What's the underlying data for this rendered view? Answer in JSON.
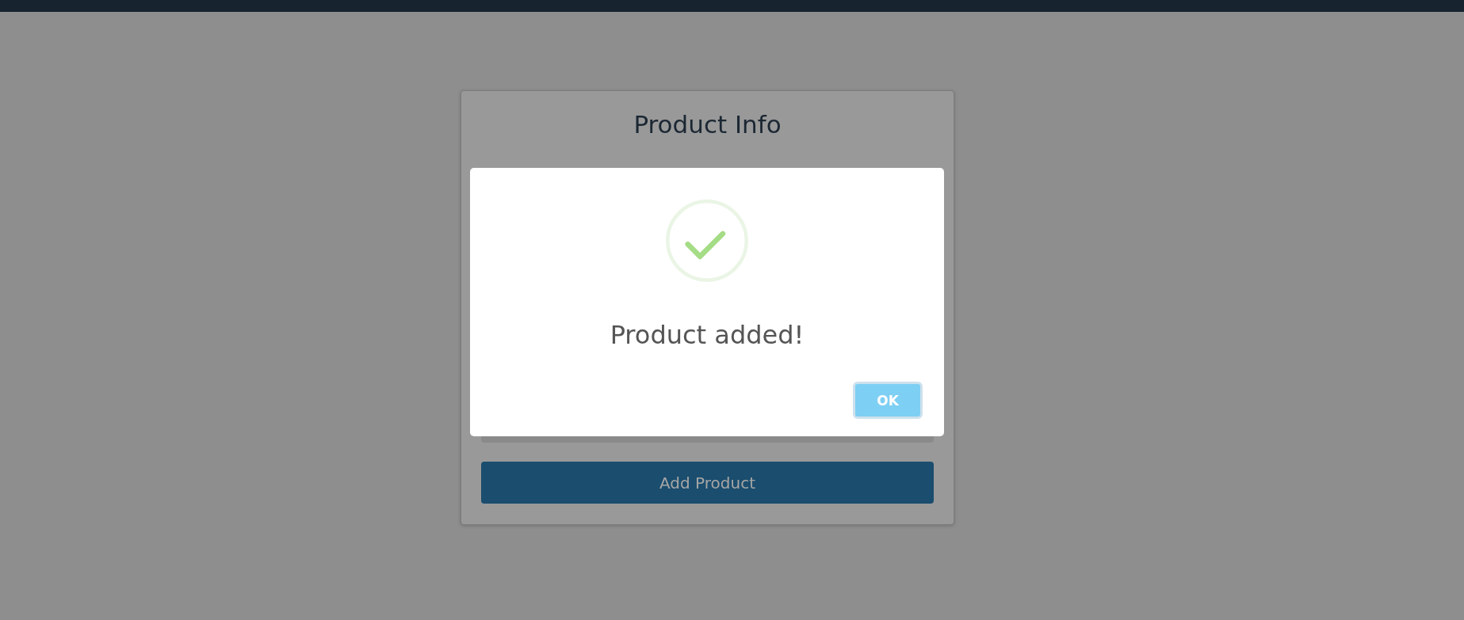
{
  "form": {
    "title": "Product Info",
    "submit_button": "Add Product"
  },
  "dialog": {
    "kind": "success",
    "message": "Product added!",
    "confirm_button": "OK"
  }
}
